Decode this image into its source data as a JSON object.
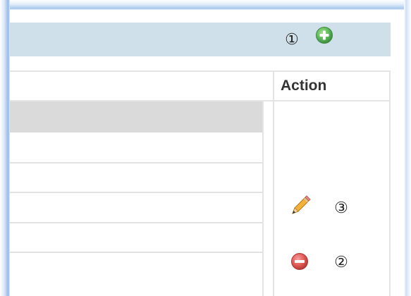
{
  "header": {
    "step_marker": "①",
    "add_icon": "plus-circle-icon"
  },
  "table": {
    "columns": [
      "Action"
    ],
    "action_header": "Action",
    "rows": [
      {
        "highlighted": true
      },
      {
        "highlighted": false
      },
      {
        "highlighted": false
      },
      {
        "highlighted": false
      },
      {
        "highlighted": false
      },
      {
        "highlighted": false
      }
    ]
  },
  "actions": {
    "edit_icon": "pencil-icon",
    "edit_marker": "③",
    "delete_icon": "minus-circle-icon",
    "delete_marker": "②"
  },
  "colors": {
    "header_bar": "#cfe0ea",
    "add_green": "#5cb85c",
    "delete_red": "#d9534f",
    "row_highlight": "#dadada",
    "border": "#e4e4e4"
  }
}
